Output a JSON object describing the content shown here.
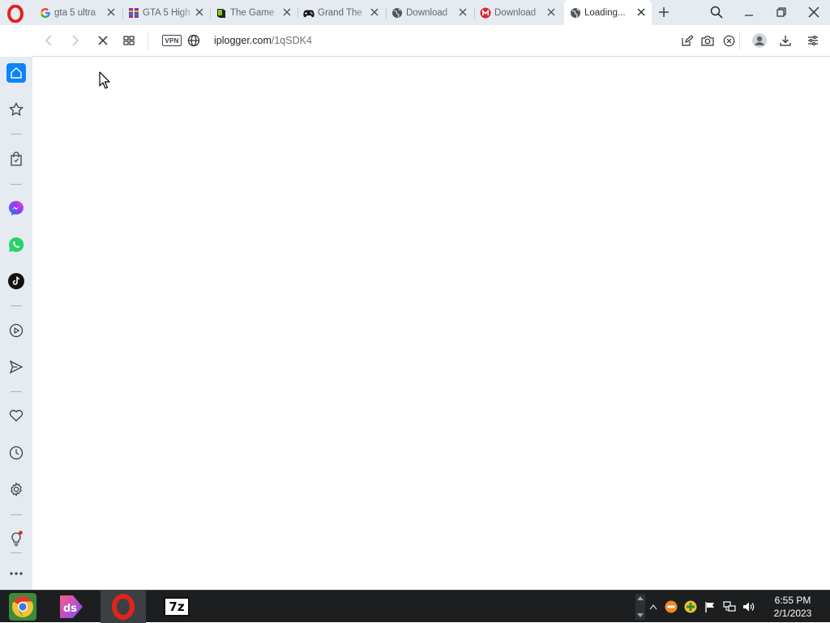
{
  "browser": {
    "name": "Opera",
    "tabs": [
      {
        "title": "gta 5 ultra",
        "favicon": "google-g-icon",
        "active": false
      },
      {
        "title": "GTA 5 High",
        "favicon": "winrar-icon",
        "active": false
      },
      {
        "title": "The Game",
        "favicon": "book-icon",
        "active": false
      },
      {
        "title": "Grand The",
        "favicon": "gamepad-icon",
        "active": false
      },
      {
        "title": "Download",
        "favicon": "globe-icon",
        "active": false
      },
      {
        "title": "Download",
        "favicon": "mega-icon",
        "active": false
      },
      {
        "title": "Loading...",
        "favicon": "globe-icon",
        "active": true
      }
    ],
    "new_tab_symbol": "+"
  },
  "addressbar": {
    "vpn_label": "VPN",
    "url_domain": "iplogger.com",
    "url_path": "/1qSDK4",
    "loading": true
  },
  "sidebar": {
    "items": [
      "home-icon",
      "star-icon",
      "shopping-bag-icon",
      "messenger-icon",
      "whatsapp-icon",
      "tiktok-icon",
      "player-icon",
      "send-icon",
      "heart-icon",
      "history-icon",
      "settings-icon",
      "lightbulb-icon",
      "more-icon"
    ]
  },
  "taskbar": {
    "apps": [
      "chrome-icon",
      "ds-icon",
      "opera-icon",
      "7zip-icon"
    ],
    "seven_zip_label": "7z",
    "ds_label": "ds",
    "time": "6:55 PM",
    "date": "2/1/2023"
  },
  "colors": {
    "accent": "#0a84ff",
    "opera_red": "#e2231a",
    "tabstrip_bg": "#e6ebf2",
    "taskbar_bg": "#1c1e20"
  }
}
